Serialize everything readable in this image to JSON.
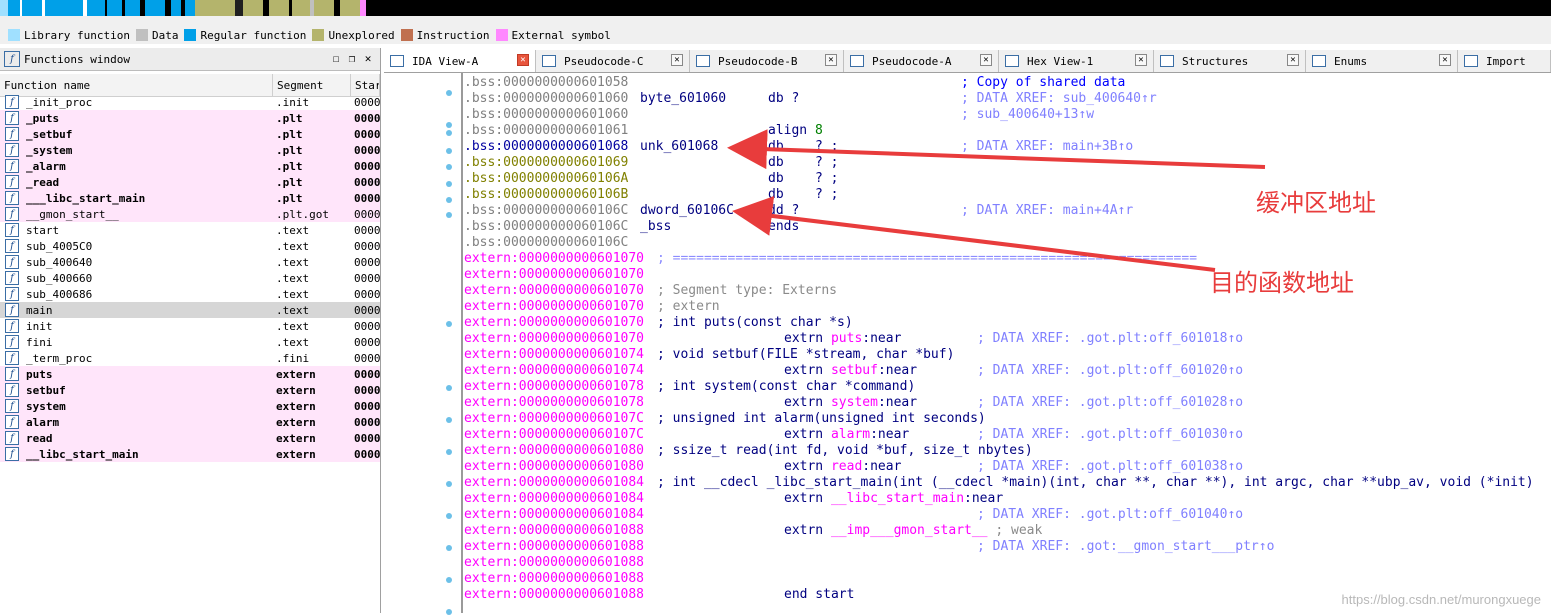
{
  "nav_colors": {
    "library": "#a0e0ff",
    "data": "#c0c0c0",
    "regular": "#00a0e8",
    "unexplored": "#b4b46c",
    "instruction": "#c07050",
    "external": "#ff88ff"
  },
  "legend": {
    "items": [
      {
        "label": "Library function",
        "color": "#a0e0ff"
      },
      {
        "label": "Data",
        "color": "#c0c0c0"
      },
      {
        "label": "Regular function",
        "color": "#00a0e8"
      },
      {
        "label": "Unexplored",
        "color": "#b4b46c"
      },
      {
        "label": "Instruction",
        "color": "#c07050"
      },
      {
        "label": "External symbol",
        "color": "#ff88ff"
      }
    ]
  },
  "functions_window": {
    "title": "Functions window",
    "icon": "function-icon",
    "columns": [
      "Function name",
      "Segment",
      "Star"
    ],
    "rows": [
      {
        "name": "_init_proc",
        "segment": ".init",
        "start": "0000",
        "style": "plain"
      },
      {
        "name": "_puts",
        "segment": ".plt",
        "start": "0000",
        "style": "pink-bold"
      },
      {
        "name": "_setbuf",
        "segment": ".plt",
        "start": "0000",
        "style": "pink-bold"
      },
      {
        "name": "_system",
        "segment": ".plt",
        "start": "0000",
        "style": "pink-bold"
      },
      {
        "name": "_alarm",
        "segment": ".plt",
        "start": "0000",
        "style": "pink-bold"
      },
      {
        "name": "_read",
        "segment": ".plt",
        "start": "0000",
        "style": "pink-bold"
      },
      {
        "name": "___libc_start_main",
        "segment": ".plt",
        "start": "0000",
        "style": "pink-bold"
      },
      {
        "name": "__gmon_start__",
        "segment": ".plt.got",
        "start": "0000",
        "style": "pink"
      },
      {
        "name": "start",
        "segment": ".text",
        "start": "0000",
        "style": "plain"
      },
      {
        "name": "sub_4005C0",
        "segment": ".text",
        "start": "0000",
        "style": "plain"
      },
      {
        "name": "sub_400640",
        "segment": ".text",
        "start": "0000",
        "style": "plain"
      },
      {
        "name": "sub_400660",
        "segment": ".text",
        "start": "0000",
        "style": "plain"
      },
      {
        "name": "sub_400686",
        "segment": ".text",
        "start": "0000",
        "style": "plain"
      },
      {
        "name": "main",
        "segment": ".text",
        "start": "0000",
        "style": "selected"
      },
      {
        "name": "init",
        "segment": ".text",
        "start": "0000",
        "style": "plain"
      },
      {
        "name": "fini",
        "segment": ".text",
        "start": "0000",
        "style": "plain"
      },
      {
        "name": "_term_proc",
        "segment": ".fini",
        "start": "0000",
        "style": "plain"
      },
      {
        "name": "puts",
        "segment": "extern",
        "start": "0000",
        "style": "pink-bold"
      },
      {
        "name": "setbuf",
        "segment": "extern",
        "start": "0000",
        "style": "pink-bold"
      },
      {
        "name": "system",
        "segment": "extern",
        "start": "0000",
        "style": "pink-bold"
      },
      {
        "name": "alarm",
        "segment": "extern",
        "start": "0000",
        "style": "pink-bold"
      },
      {
        "name": "read",
        "segment": "extern",
        "start": "0000",
        "style": "pink-bold"
      },
      {
        "name": "__libc_start_main",
        "segment": "extern",
        "start": "0000",
        "style": "pink-bold"
      }
    ]
  },
  "tabs": [
    {
      "label": "IDA View-A",
      "active": true
    },
    {
      "label": "Pseudocode-C",
      "active": false
    },
    {
      "label": "Pseudocode-B",
      "active": false
    },
    {
      "label": "Pseudocode-A",
      "active": false
    },
    {
      "label": "Hex View-1",
      "active": false
    },
    {
      "label": "Structures",
      "active": false
    },
    {
      "label": "Enums",
      "active": false
    },
    {
      "label": "Import",
      "active": false
    }
  ],
  "disasm": [
    {
      "addr": ".bss:0000000000601058",
      "kind": "bss",
      "cmt": "; Copy of shared data",
      "cmtcls": "c"
    },
    {
      "addr": ".bss:0000000000601060",
      "kind": "bss",
      "c2": "byte_601060",
      "c3": "db ?",
      "cmt": "; DATA XREF: sub_400640↑r"
    },
    {
      "addr": ".bss:0000000000601060",
      "kind": "bss",
      "cmt": "; sub_400640+13↑w"
    },
    {
      "addr": ".bss:0000000000601061",
      "kind": "bss",
      "c3": "align 8",
      "num": "8"
    },
    {
      "addr": ".bss:0000000000601068",
      "kind": "hl",
      "c2": "unk_601068",
      "c3": "db    ? ;",
      "cmt": "; DATA XREF: main+3B↑o"
    },
    {
      "addr": ".bss:0000000000601069",
      "kind": "yel",
      "c3": "db    ? ;"
    },
    {
      "addr": ".bss:000000000060106A",
      "kind": "yel",
      "c3": "db    ? ;"
    },
    {
      "addr": ".bss:000000000060106B",
      "kind": "yel",
      "c3": "db    ? ;"
    },
    {
      "addr": ".bss:000000000060106C",
      "kind": "bss",
      "c2": "dword_60106C",
      "c3": "dd ?",
      "cmt": "; DATA XREF: main+4A↑r"
    },
    {
      "addr": ".bss:000000000060106C",
      "kind": "bss",
      "c2": "_bss",
      "c3": "ends"
    },
    {
      "addr": ".bss:000000000060106C",
      "kind": "bss"
    },
    {
      "addr": "extern:0000000000601070",
      "kind": "ext",
      "sep": "; ==================================================================="
    },
    {
      "addr": "extern:0000000000601070",
      "kind": "ext"
    },
    {
      "addr": "extern:0000000000601070",
      "kind": "ext",
      "grey": "; Segment type: Externs"
    },
    {
      "addr": "extern:0000000000601070",
      "kind": "ext",
      "grey": "; extern"
    },
    {
      "addr": "extern:0000000000601070",
      "kind": "ext",
      "decl": "; int puts(const char *s)"
    },
    {
      "addr": "extern:0000000000601070",
      "kind": "ext",
      "ext": "extrn ",
      "sym": "puts",
      "tail": ":near",
      "cmt2": "; DATA XREF: .got.plt:off_601018↑o"
    },
    {
      "addr": "extern:0000000000601074",
      "kind": "ext",
      "decl": "; void setbuf(FILE *stream, char *buf)"
    },
    {
      "addr": "extern:0000000000601074",
      "kind": "ext",
      "ext": "extrn ",
      "sym": "setbuf",
      "tail": ":near",
      "cmt2": "; DATA XREF: .got.plt:off_601020↑o"
    },
    {
      "addr": "extern:0000000000601078",
      "kind": "ext",
      "decl": "; int system(const char *command)"
    },
    {
      "addr": "extern:0000000000601078",
      "kind": "ext",
      "ext": "extrn ",
      "sym": "system",
      "tail": ":near",
      "cmt2": "; DATA XREF: .got.plt:off_601028↑o"
    },
    {
      "addr": "extern:000000000060107C",
      "kind": "ext",
      "decl": "; unsigned int alarm(unsigned int seconds)"
    },
    {
      "addr": "extern:000000000060107C",
      "kind": "ext",
      "ext": "extrn ",
      "sym": "alarm",
      "tail": ":near",
      "cmt2": "; DATA XREF: .got.plt:off_601030↑o"
    },
    {
      "addr": "extern:0000000000601080",
      "kind": "ext",
      "decl": "; ssize_t read(int fd, void *buf, size_t nbytes)"
    },
    {
      "addr": "extern:0000000000601080",
      "kind": "ext",
      "ext": "extrn ",
      "sym": "read",
      "tail": ":near",
      "cmt2": "; DATA XREF: .got.plt:off_601038↑o"
    },
    {
      "addr": "extern:0000000000601084",
      "kind": "ext",
      "decl": "; int __cdecl _libc_start_main(int (__cdecl *main)(int, char **, char **), int argc, char **ubp_av, void (*init)"
    },
    {
      "addr": "extern:0000000000601084",
      "kind": "ext",
      "ext": "extrn ",
      "sym": "__libc_start_main",
      "tail": ":near"
    },
    {
      "addr": "extern:0000000000601084",
      "kind": "ext",
      "cmt2": "; DATA XREF: .got.plt:off_601040↑o"
    },
    {
      "addr": "extern:0000000000601088",
      "kind": "ext",
      "ext": "extrn ",
      "sym": "__imp___gmon_start__",
      "tail": " ; weak"
    },
    {
      "addr": "extern:0000000000601088",
      "kind": "ext",
      "cmt2": "; DATA XREF: .got:__gmon_start___ptr↑o"
    },
    {
      "addr": "extern:0000000000601088",
      "kind": "ext"
    },
    {
      "addr": "extern:0000000000601088",
      "kind": "ext"
    },
    {
      "addr": "extern:0000000000601088",
      "kind": "ext",
      "ext": "end start"
    }
  ],
  "annotations": {
    "buffer": "缓冲区地址",
    "target": "目的函数地址",
    "color": "#e83c3c"
  },
  "watermark": "https://blog.csdn.net/murongxuege"
}
